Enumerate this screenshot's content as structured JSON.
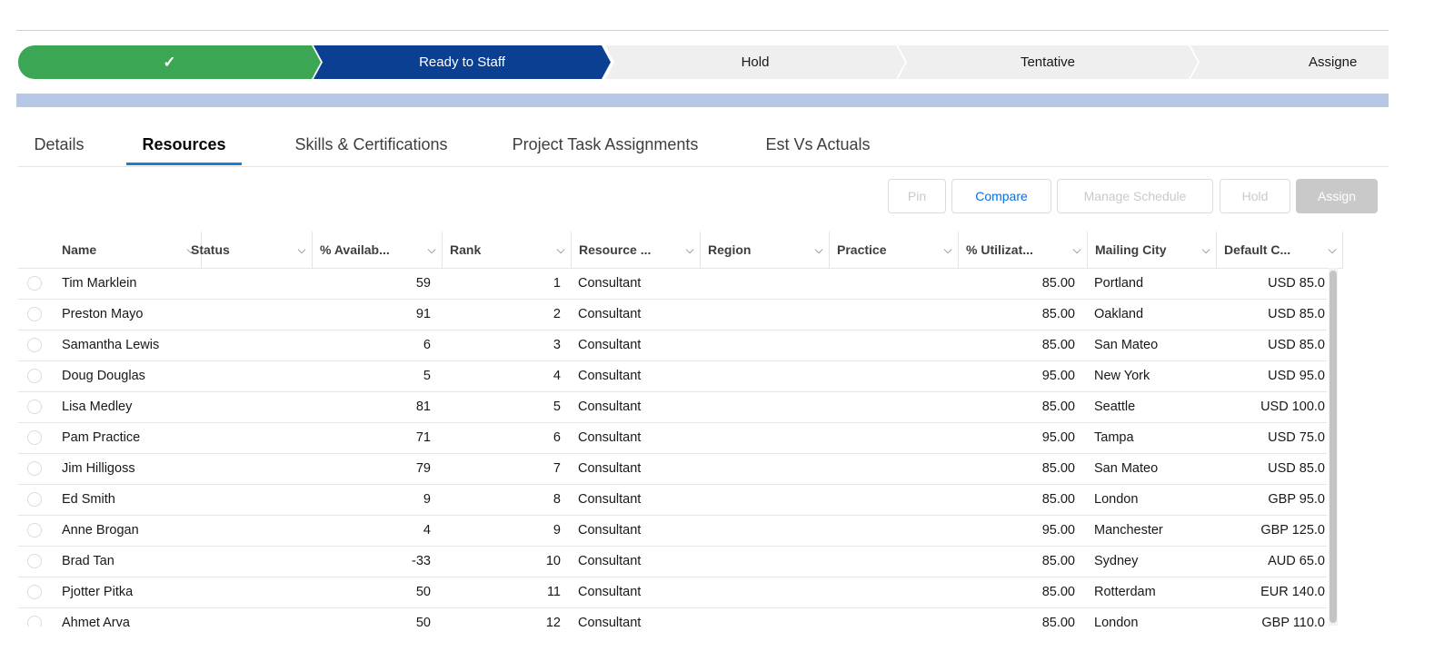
{
  "path": {
    "stages": [
      {
        "label": "",
        "icon": "check-icon",
        "state": "complete"
      },
      {
        "label": "Ready to Staff",
        "state": "current"
      },
      {
        "label": "Hold",
        "state": "incomplete"
      },
      {
        "label": "Tentative",
        "state": "incomplete"
      },
      {
        "label": "Assigne",
        "state": "incomplete"
      }
    ],
    "complete_glyph": "✓"
  },
  "tabs": [
    {
      "label": "Details"
    },
    {
      "label": "Resources",
      "active": true
    },
    {
      "label": "Skills & Certifications"
    },
    {
      "label": "Project Task Assignments"
    },
    {
      "label": "Est Vs Actuals"
    }
  ],
  "toolbar": {
    "pin": "Pin",
    "compare": "Compare",
    "manage_schedule": "Manage Schedule",
    "hold": "Hold",
    "assign": "Assign"
  },
  "table": {
    "columns": [
      "Name",
      "Status",
      "% Availab...",
      "Rank",
      "Resource ...",
      "Region",
      "Practice",
      "% Utilizat...",
      "Mailing City",
      "Default C..."
    ],
    "chevron": "⌵",
    "rows": [
      {
        "name": "Tim Marklein",
        "status": "",
        "availability": "59",
        "rank": "1",
        "resource": "Consultant",
        "region": "",
        "practice": "",
        "utilization": "85.00",
        "city": "Portland",
        "default_cost": "USD 85.0"
      },
      {
        "name": "Preston Mayo",
        "status": "",
        "availability": "91",
        "rank": "2",
        "resource": "Consultant",
        "region": "",
        "practice": "",
        "utilization": "85.00",
        "city": "Oakland",
        "default_cost": "USD 85.0"
      },
      {
        "name": "Samantha Lewis",
        "status": "",
        "availability": "6",
        "rank": "3",
        "resource": "Consultant",
        "region": "",
        "practice": "",
        "utilization": "85.00",
        "city": "San Mateo",
        "default_cost": "USD 85.0"
      },
      {
        "name": "Doug Douglas",
        "status": "",
        "availability": "5",
        "rank": "4",
        "resource": "Consultant",
        "region": "",
        "practice": "",
        "utilization": "95.00",
        "city": "New York",
        "default_cost": "USD 95.0"
      },
      {
        "name": "Lisa Medley",
        "status": "",
        "availability": "81",
        "rank": "5",
        "resource": "Consultant",
        "region": "",
        "practice": "",
        "utilization": "85.00",
        "city": "Seattle",
        "default_cost": "USD 100.0"
      },
      {
        "name": "Pam Practice",
        "status": "",
        "availability": "71",
        "rank": "6",
        "resource": "Consultant",
        "region": "",
        "practice": "",
        "utilization": "95.00",
        "city": "Tampa",
        "default_cost": "USD 75.0"
      },
      {
        "name": "Jim Hilligoss",
        "status": "",
        "availability": "79",
        "rank": "7",
        "resource": "Consultant",
        "region": "",
        "practice": "",
        "utilization": "85.00",
        "city": "San Mateo",
        "default_cost": "USD 85.0"
      },
      {
        "name": "Ed Smith",
        "status": "",
        "availability": "9",
        "rank": "8",
        "resource": "Consultant",
        "region": "",
        "practice": "",
        "utilization": "85.00",
        "city": "London",
        "default_cost": "GBP 95.0"
      },
      {
        "name": "Anne Brogan",
        "status": "",
        "availability": "4",
        "rank": "9",
        "resource": "Consultant",
        "region": "",
        "practice": "",
        "utilization": "95.00",
        "city": "Manchester",
        "default_cost": "GBP 125.0"
      },
      {
        "name": "Brad Tan",
        "status": "",
        "availability": "-33",
        "rank": "10",
        "resource": "Consultant",
        "region": "",
        "practice": "",
        "utilization": "85.00",
        "city": "Sydney",
        "default_cost": "AUD 65.0"
      },
      {
        "name": "Pjotter Pitka",
        "status": "",
        "availability": "50",
        "rank": "11",
        "resource": "Consultant",
        "region": "",
        "practice": "",
        "utilization": "85.00",
        "city": "Rotterdam",
        "default_cost": "EUR 140.0"
      },
      {
        "name": "Ahmet Arva",
        "status": "",
        "availability": "50",
        "rank": "12",
        "resource": "Consultant",
        "region": "",
        "practice": "",
        "utilization": "85.00",
        "city": "London",
        "default_cost": "GBP 110.0"
      }
    ]
  }
}
